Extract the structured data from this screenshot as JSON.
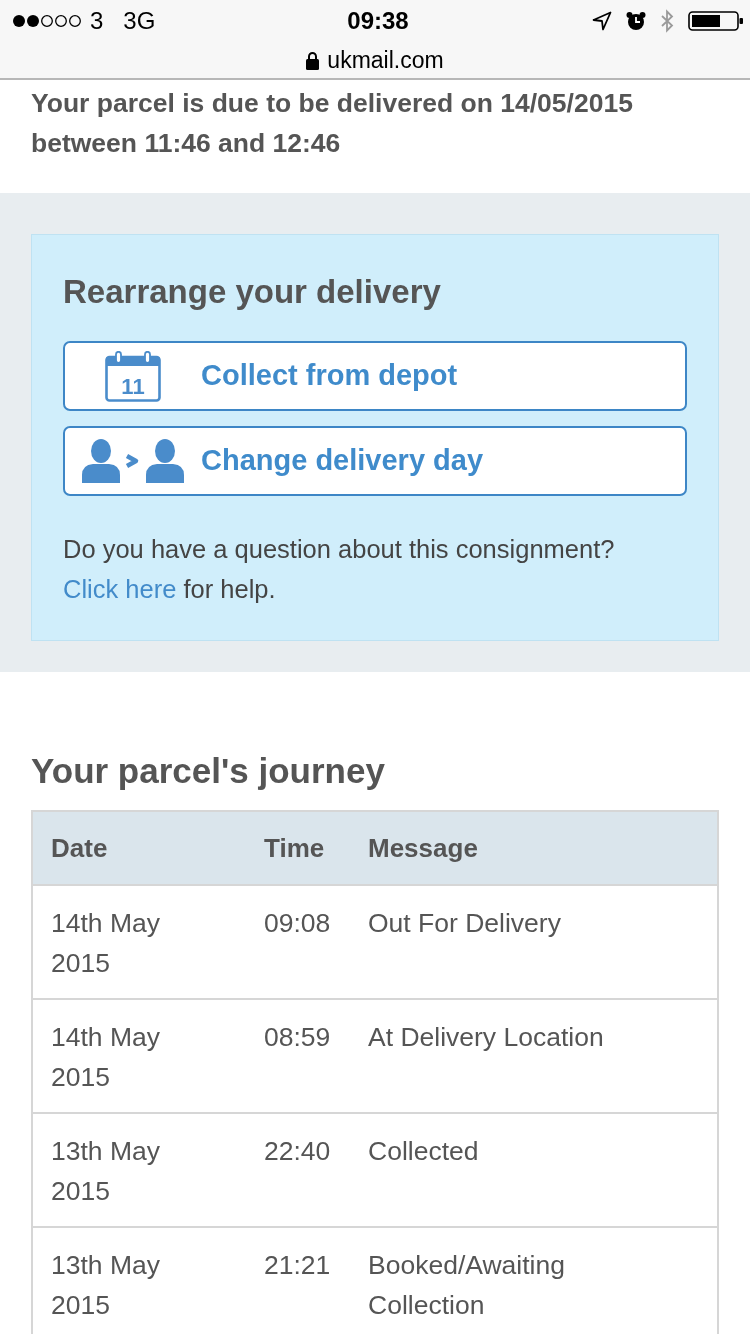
{
  "status_bar": {
    "carrier": "3",
    "network": "3G",
    "time": "09:38"
  },
  "address_bar": {
    "url": "ukmail.com"
  },
  "delivery_notice": "Your parcel is due to be delivered on 14/05/2015 between 11:46 and 12:46",
  "rearrange": {
    "title": "Rearrange your delivery",
    "options": [
      {
        "kind": "calendar",
        "icon_text": "11",
        "label": "Collect from depot"
      },
      {
        "kind": "person-swap",
        "label": "Change delivery day"
      }
    ],
    "help": {
      "text": "Do you have a question about this consignment?",
      "link": "Click here",
      "after": "for help."
    }
  },
  "journey": {
    "title": "Your parcel's journey",
    "columns": [
      "Date",
      "Time",
      "Message"
    ],
    "rows": [
      [
        "14th May 2015",
        "09:08",
        "Out For Delivery"
      ],
      [
        "14th May 2015",
        "08:59",
        "At Delivery Location"
      ],
      [
        "13th May 2015",
        "22:40",
        "Collected"
      ],
      [
        "13th May 2015",
        "21:21",
        "Booked/Awaiting Collection"
      ]
    ]
  }
}
